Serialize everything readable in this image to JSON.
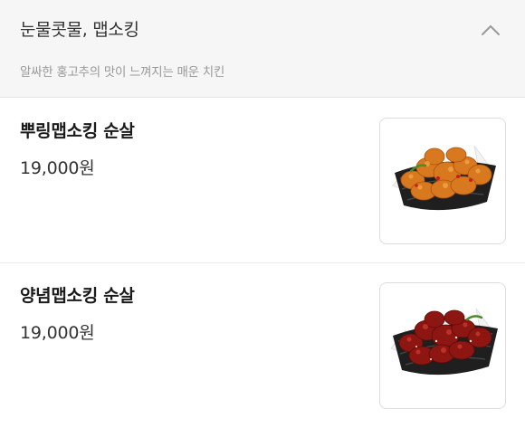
{
  "category": {
    "title": "눈물콧물, 맵소킹",
    "description": "알싸한 홍고추의 맛이 느껴지는 매운 치킨",
    "toggle_icon": "chevron-up-icon"
  },
  "menu_items": [
    {
      "name": "뿌링맵소킹 순살",
      "price": "19,000원",
      "photo_icon": "golden-fried-chicken-basket"
    },
    {
      "name": "양념맵소킹 순살",
      "price": "19,000원",
      "photo_icon": "red-sauced-chicken-basket"
    }
  ],
  "colors": {
    "header_bg": "#f6f6f6",
    "divider": "#e4e4e4",
    "desc_text": "#999999",
    "photo_border": "#dddddd"
  }
}
